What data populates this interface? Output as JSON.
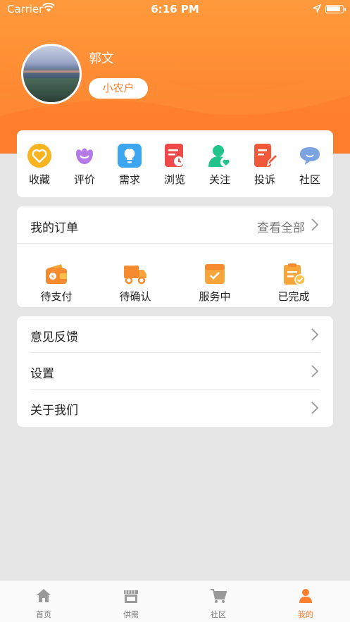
{
  "status_bar": {
    "carrier": "Carrier",
    "time": "6:16 PM"
  },
  "profile": {
    "name": "郭文",
    "badge": "小农户"
  },
  "quick_actions": [
    {
      "label": "收藏",
      "icon": "heart-icon",
      "color": "#f7b320"
    },
    {
      "label": "评价",
      "icon": "flower-icon",
      "color": "#b57ae8"
    },
    {
      "label": "需求",
      "icon": "lightbulb-icon",
      "color": "#3da6f0"
    },
    {
      "label": "浏览",
      "icon": "history-doc-icon",
      "color": "#ef4a4a"
    },
    {
      "label": "关注",
      "icon": "user-heart-icon",
      "color": "#22c48c"
    },
    {
      "label": "投诉",
      "icon": "complaint-doc-icon",
      "color": "#f05a3b"
    },
    {
      "label": "社区",
      "icon": "chat-bubble-icon",
      "color": "#7ba3e0"
    }
  ],
  "orders": {
    "title": "我的订单",
    "view_all": "查看全部",
    "items": [
      {
        "label": "待支付",
        "icon": "wallet-icon"
      },
      {
        "label": "待确认",
        "icon": "truck-icon"
      },
      {
        "label": "服务中",
        "icon": "box-check-icon"
      },
      {
        "label": "已完成",
        "icon": "clipboard-done-icon"
      }
    ]
  },
  "menu": [
    {
      "label": "意见反馈"
    },
    {
      "label": "设置"
    },
    {
      "label": "关于我们"
    }
  ],
  "tabbar": [
    {
      "label": "首页",
      "icon": "home-icon"
    },
    {
      "label": "供需",
      "icon": "store-icon"
    },
    {
      "label": "社区",
      "icon": "cart-icon"
    },
    {
      "label": "我的",
      "icon": "person-icon",
      "active": true
    }
  ],
  "colors": {
    "accent": "#ff7f2f",
    "header_top": "#ff9a3c",
    "background": "#e6e6e6"
  }
}
